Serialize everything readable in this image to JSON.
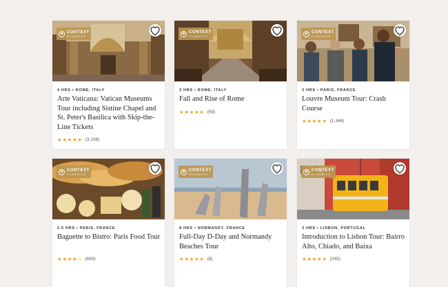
{
  "badge": {
    "line1": "CONTEXT",
    "line2": "CLASSICS"
  },
  "tours": [
    {
      "meta": "4 HRS • ROME, ITALY",
      "title": "Arte Vaticana: Vatican Museums Tour including Sistine Chapel and St. Peter's Basilica with Skip-the-Line Tickets",
      "stars": "★★★★★",
      "rating": 5,
      "count": "(3,108)"
    },
    {
      "meta": "3 HRS • ROME, ITALY",
      "title": "Fall and Rise of Rome",
      "stars": "★★★★★",
      "rating": 5,
      "count": "(59)"
    },
    {
      "meta": "3 HRS • PARIS, FRANCE",
      "title": "Louvre Museum Tour: Crash Course",
      "stars": "★★★★★",
      "rating": 5,
      "count": "(1,346)"
    },
    {
      "meta": "2.5 HRS • PARIS, FRANCE",
      "title": "Baguette to Bistro: Paris Food Tour",
      "stars": "★★★★☆",
      "rating": 4.5,
      "count": "(683)"
    },
    {
      "meta": "8 HRS • NORMANDY, FRANCE",
      "title": "Full-Day D-Day and Normandy Beaches Tour",
      "stars": "★★★★★",
      "rating": 5,
      "count": "(8)"
    },
    {
      "meta": "3 HRS • LISBON, PORTUGAL",
      "title": "Introduction to Lisbon Tour: Bairro Alto, Chiado, and Baixa",
      "stars": "★★★★★",
      "rating": 5,
      "count": "(245)"
    }
  ],
  "colors": {
    "background": "#f2efec",
    "star": "#f0a020",
    "badge": "#bc9650",
    "card": "#ffffff"
  },
  "icons": {
    "favorite": "heart-icon",
    "brand": "context-logo-icon"
  }
}
